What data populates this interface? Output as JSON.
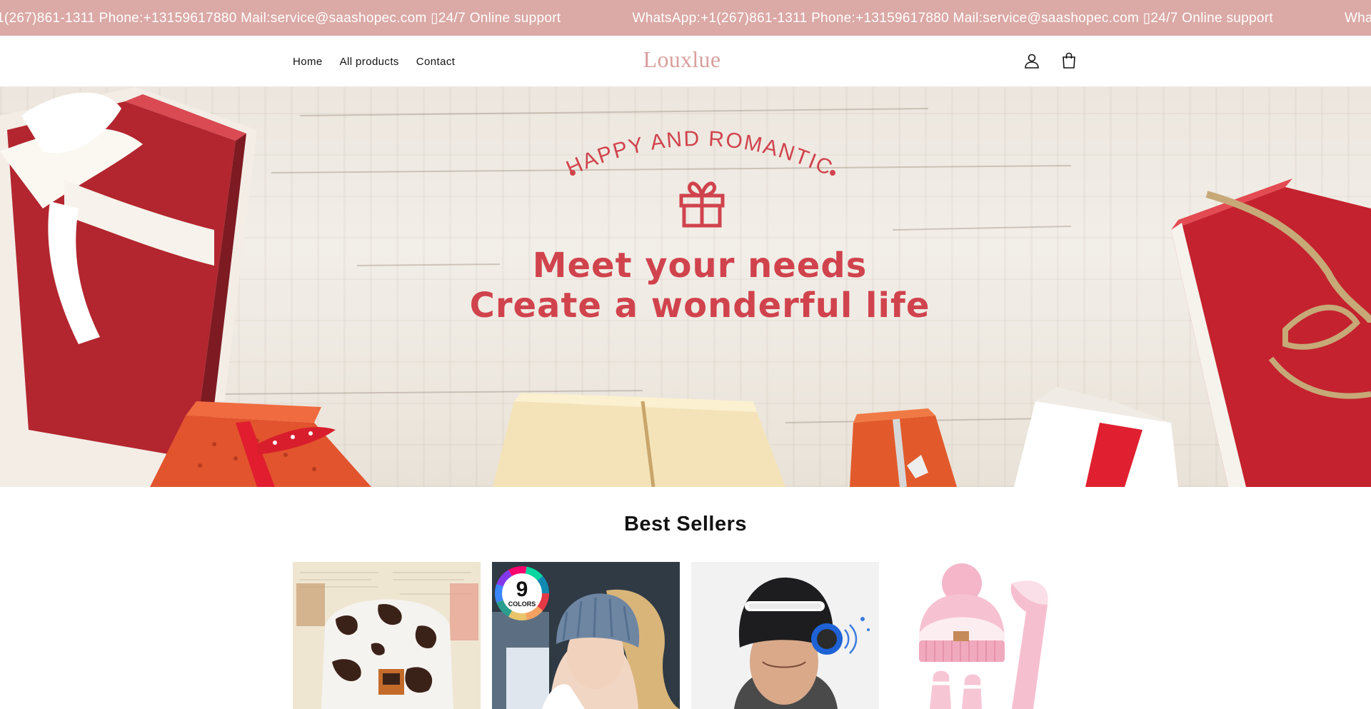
{
  "announcement": {
    "items": [
      "WhatsApp:+1(267)861-1311 Phone:+13159617880 Mail:service@saashopec.com ▯24/7 Online support",
      "WhatsApp:+1(267)861-1311 Phone:+13159617880 Mail:service@saashopec.com ▯24/7 Online support",
      "WhatsApp:+1(267)861-1311 Phone:+13159617880 Mail:service@saashopec.com ▯24/7 Online support"
    ],
    "background": "#dba9a6"
  },
  "header": {
    "nav": [
      {
        "label": "Home"
      },
      {
        "label": "All products"
      },
      {
        "label": "Contact"
      }
    ],
    "logo": "Louxlue",
    "icons": [
      "account-icon",
      "cart-icon"
    ]
  },
  "hero": {
    "kicker": "HAPPY AND ROMANTIC",
    "line1": "Meet your needs",
    "line2": "Create a wonderful life",
    "accent": "#d0434d"
  },
  "best_sellers": {
    "title": "Best Sellers",
    "products": [
      {
        "image": "cow-print-beanie"
      },
      {
        "image": "ponytail-beanie-9-colors",
        "badge_number": "9",
        "badge_text": "COLORS"
      },
      {
        "image": "led-bluetooth-beanie"
      },
      {
        "image": "pink-hat-scarf-gloves-set"
      }
    ]
  }
}
